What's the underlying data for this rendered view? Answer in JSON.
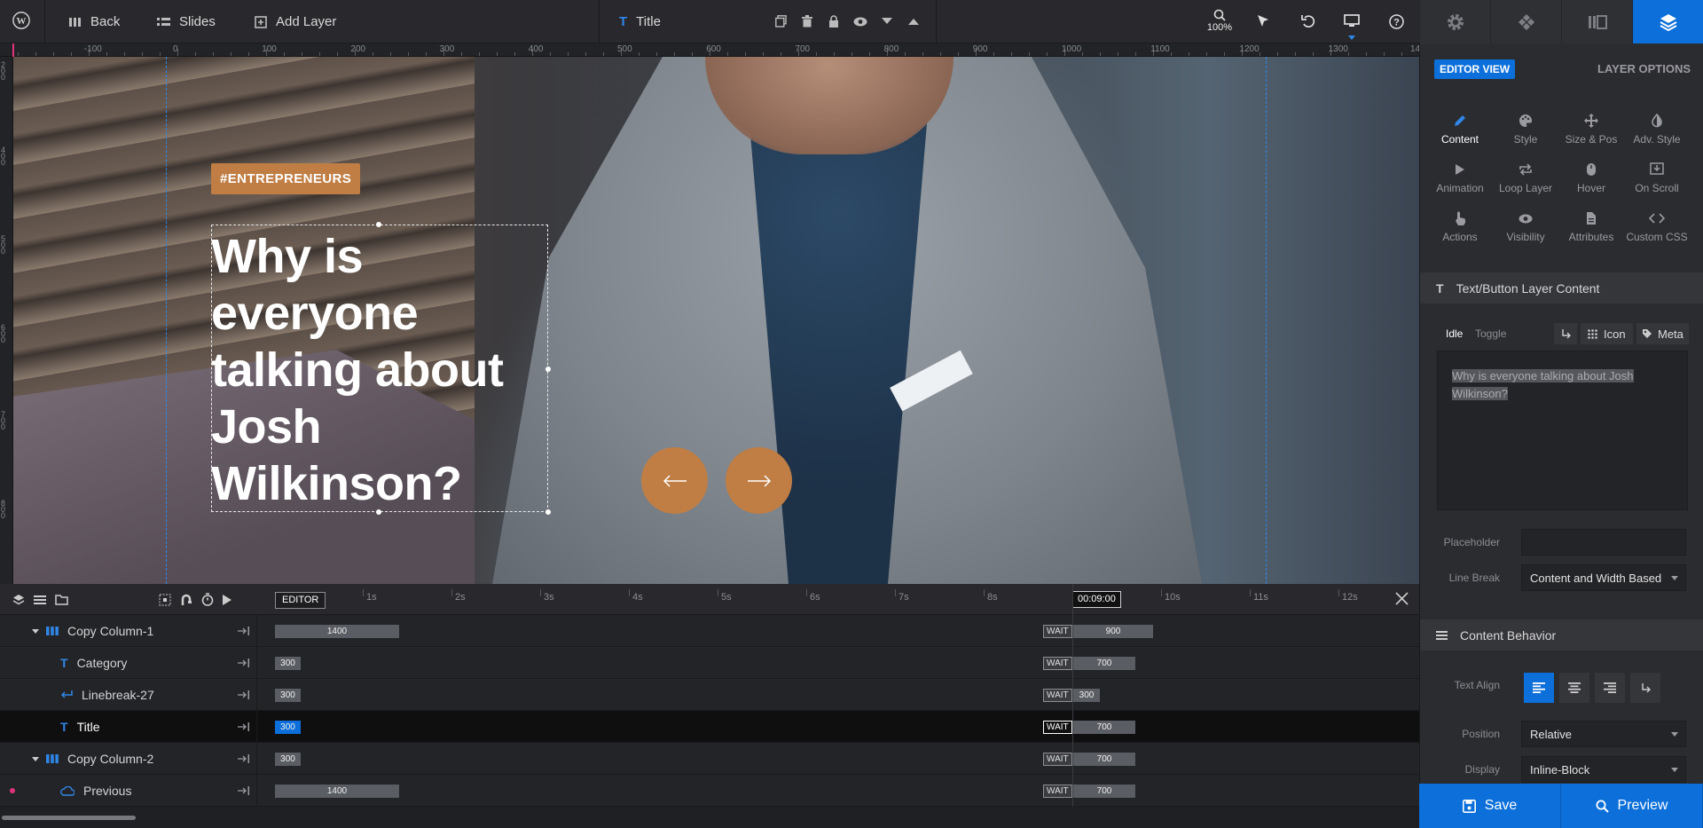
{
  "topbar": {
    "back": "Back",
    "slides": "Slides",
    "add_layer": "Add Layer",
    "layer_name": "Title",
    "zoom": "100%"
  },
  "ruler": {
    "labels": [
      "-100",
      "0",
      "100",
      "200",
      "300",
      "400",
      "500",
      "600",
      "700",
      "800",
      "900",
      "1000",
      "1100",
      "1200",
      "1300",
      "14"
    ]
  },
  "canvas": {
    "tag": "#ENTREPRENEURS",
    "title_lines": [
      "Why is",
      "everyone",
      "talking about",
      "Josh",
      "Wilkinson?"
    ]
  },
  "timeline": {
    "editor_label": "EDITOR",
    "time_marks": [
      "1s",
      "2s",
      "3s",
      "4s",
      "5s",
      "6s",
      "7s",
      "8s",
      "10s",
      "11s",
      "12s"
    ],
    "current_time": "00:09:00",
    "wait_label": "WAIT",
    "rows": [
      {
        "name": "Copy Column-1",
        "icon": "column-icon",
        "start": "1400",
        "end": "900"
      },
      {
        "name": "Category",
        "icon": "text-icon",
        "start": "300",
        "end": "700"
      },
      {
        "name": "Linebreak-27",
        "icon": "linebreak-icon",
        "start": "300",
        "end": "300"
      },
      {
        "name": "Title",
        "icon": "text-icon",
        "start": "300",
        "end": "700"
      },
      {
        "name": "Copy Column-2",
        "icon": "column-icon",
        "start": "300",
        "end": "700"
      },
      {
        "name": "Previous",
        "icon": "cloud-icon",
        "start": "1400",
        "end": "700"
      }
    ]
  },
  "panel": {
    "editor_view": "EDITOR VIEW",
    "layer_options": "LAYER OPTIONS",
    "tabs": [
      {
        "label": "Content",
        "icon": "pencil-icon"
      },
      {
        "label": "Style",
        "icon": "palette-icon"
      },
      {
        "label": "Size & Pos",
        "icon": "move-icon"
      },
      {
        "label": "Adv. Style",
        "icon": "contrast-icon"
      },
      {
        "label": "Animation",
        "icon": "play-icon"
      },
      {
        "label": "Loop Layer",
        "icon": "loop-icon"
      },
      {
        "label": "Hover",
        "icon": "mouse-icon"
      },
      {
        "label": "On Scroll",
        "icon": "scroll-icon"
      },
      {
        "label": "Actions",
        "icon": "hand-icon"
      },
      {
        "label": "Visibility",
        "icon": "eye-icon"
      },
      {
        "label": "Attributes",
        "icon": "file-icon"
      },
      {
        "label": "Custom CSS",
        "icon": "code-icon"
      }
    ],
    "content_section": "Text/Button Layer Content",
    "idle": "Idle",
    "toggle": "Toggle",
    "icon_btn": "Icon",
    "meta_btn": "Meta",
    "content_text": "Why is everyone talking about Josh Wilkinson?",
    "placeholder_label": "Placeholder",
    "linebreak_label": "Line Break",
    "linebreak_value": "Content and Width Based",
    "behavior_section": "Content Behavior",
    "text_align_label": "Text Align",
    "position_label": "Position",
    "position_value": "Relative",
    "display_label": "Display",
    "display_value": "Inline-Block",
    "save": "Save",
    "preview": "Preview"
  }
}
